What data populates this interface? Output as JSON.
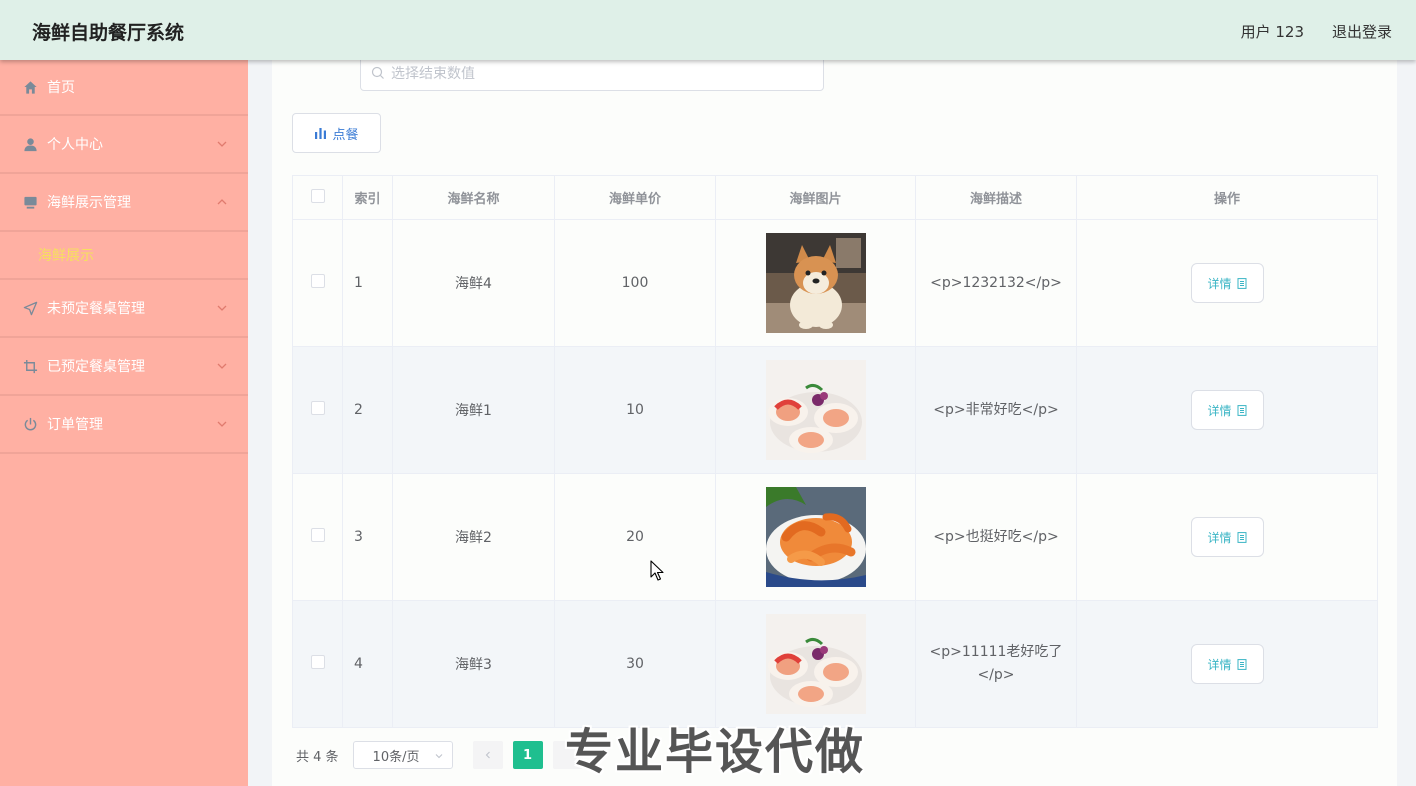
{
  "app": {
    "title": "海鲜自助餐厅系统"
  },
  "header": {
    "user": "用户 123",
    "logout": "退出登录"
  },
  "sidebar": {
    "items": [
      {
        "label": "首页",
        "icon": "home-icon"
      },
      {
        "label": "个人中心",
        "icon": "user-icon"
      },
      {
        "label": "海鲜展示管理",
        "icon": "monitor-icon",
        "expanded": true,
        "sub": "海鲜展示"
      },
      {
        "label": "未预定餐桌管理",
        "icon": "send-icon"
      },
      {
        "label": "已预定餐桌管理",
        "icon": "crop-icon"
      },
      {
        "label": "订单管理",
        "icon": "power-icon"
      }
    ]
  },
  "search": {
    "placeholder": "选择结束数值"
  },
  "toolbar": {
    "order_label": "点餐"
  },
  "table": {
    "headers": [
      "索引",
      "海鲜名称",
      "海鲜单价",
      "海鲜图片",
      "海鲜描述",
      "操作"
    ],
    "rows": [
      {
        "index": "1",
        "name": "海鲜4",
        "price": "100",
        "image": "dog-photo",
        "desc": "<p>1232132</p>"
      },
      {
        "index": "2",
        "name": "海鲜1",
        "price": "10",
        "image": "scallop-photo",
        "desc": "<p>非常好吃</p>"
      },
      {
        "index": "3",
        "name": "海鲜2",
        "price": "20",
        "image": "shrimp-photo",
        "desc": "<p>也挺好吃</p>"
      },
      {
        "index": "4",
        "name": "海鲜3",
        "price": "30",
        "image": "scallop-photo",
        "desc": "<p>11111老好吃了</p>"
      }
    ],
    "detail_label": "详情"
  },
  "pagination": {
    "total": "共 4 条",
    "page_size": "10条/页",
    "current_page": "1"
  },
  "watermark": "专业毕设代做",
  "colors": {
    "header_bg": "#dff0e8",
    "sidebar_bg": "#ffb0a3",
    "active_sub": "#f6e05e",
    "page_active": "#1fbf8f",
    "detail_text": "#3ab5c5"
  }
}
